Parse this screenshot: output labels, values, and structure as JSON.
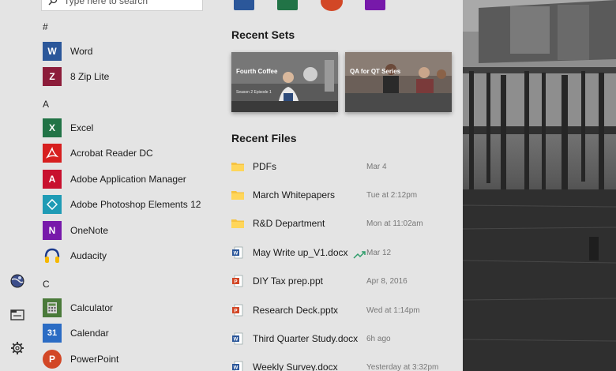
{
  "search": {
    "placeholder": "Type here to search"
  },
  "left_rail": {
    "items": [
      {
        "icon": "globe-icon"
      },
      {
        "icon": "file-explorer-icon"
      },
      {
        "icon": "gear-icon"
      }
    ]
  },
  "app_list": {
    "sections": [
      {
        "letter": "#",
        "apps": [
          {
            "label": "Word",
            "icon": "word-icon",
            "color": "#2b579a"
          },
          {
            "label": "8 Zip Lite",
            "icon": "8zip-icon",
            "color": "#8c1c3a"
          }
        ]
      },
      {
        "letter": "A",
        "apps": [
          {
            "label": "Excel",
            "icon": "excel-icon",
            "color": "#217346"
          },
          {
            "label": "Acrobat Reader DC",
            "icon": "acrobat-icon",
            "color": "#d71f1f"
          },
          {
            "label": "Adobe Application Manager",
            "icon": "adobe-icon",
            "color": "#c8102e"
          },
          {
            "label": "Adobe Photoshop Elements 12",
            "icon": "photoshop-elements-icon",
            "color": "#1f9bb5"
          },
          {
            "label": "OneNote",
            "icon": "onenote-icon",
            "color": "#7719aa"
          },
          {
            "label": "Audacity",
            "icon": "audacity-icon",
            "color": "#f5b800"
          }
        ]
      },
      {
        "letter": "C",
        "apps": [
          {
            "label": "Calculator",
            "icon": "calculator-icon",
            "color": "#4a7a3a"
          },
          {
            "label": "Calendar",
            "icon": "calendar-icon",
            "color": "#2b6cc4"
          },
          {
            "label": "PowerPoint",
            "icon": "powerpoint-icon",
            "color": "#d24726"
          }
        ]
      }
    ]
  },
  "recent_sets": {
    "heading": "Recent Sets",
    "tiles": [
      {
        "title": "Fourth Coffee",
        "subtitle": "Season 2 Episode 1"
      },
      {
        "title": "QA for QT Series",
        "subtitle": ""
      }
    ]
  },
  "recent_files": {
    "heading": "Recent Files",
    "items": [
      {
        "name": "PDFs",
        "date": "Mar 4",
        "type": "folder",
        "trending": false
      },
      {
        "name": "March Whitepapers",
        "date": "Tue at 2:12pm",
        "type": "folder",
        "trending": false
      },
      {
        "name": "R&D Department",
        "date": "Mon at 11:02am",
        "type": "folder",
        "trending": false
      },
      {
        "name": "May Write up_V1.docx",
        "date": "Mar 12",
        "type": "word",
        "trending": true
      },
      {
        "name": "DIY Tax prep.ppt",
        "date": "Apr 8, 2016",
        "type": "powerpoint",
        "trending": false
      },
      {
        "name": "Research Deck.pptx",
        "date": "Wed at 1:14pm",
        "type": "powerpoint",
        "trending": false
      },
      {
        "name": "Third Quarter Study.docx",
        "date": "6h ago",
        "type": "word",
        "trending": false
      },
      {
        "name": "Weekly Survey.docx",
        "date": "Yesterday at 3:32pm",
        "type": "word",
        "trending": false
      }
    ]
  },
  "pinned_top": [
    "word-icon",
    "excel-icon",
    "powerpoint-icon",
    "onenote-icon"
  ],
  "colors": {
    "menu_bg": "#e4e4e4",
    "folder": "#f6c342",
    "word": "#2b579a",
    "ppt": "#d24726",
    "trend": "#2e9c6a"
  }
}
